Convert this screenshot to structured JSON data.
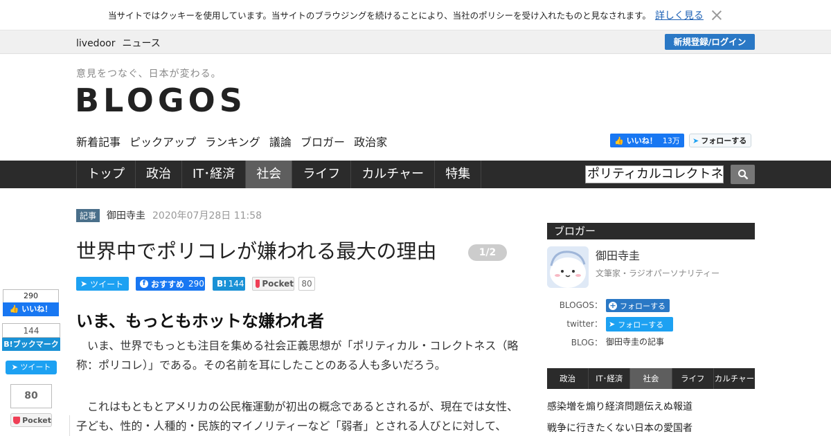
{
  "cookie": {
    "text": "当サイトではクッキーを使用しています。当サイトのブラウジングを続けることにより、当社のポリシーを受け入れたものと見なされます。",
    "link": "詳しく見る"
  },
  "topnav": {
    "brand1": "livedoor",
    "brand2": "ニュース",
    "login": "新規登録/ログイン"
  },
  "header": {
    "tagline": "意見をつなぐ、日本が変わる。",
    "logo": "BLOGOS",
    "sections": [
      "新着記事",
      "ピックアップ",
      "ランキング",
      "議論",
      "ブロガー",
      "政治家"
    ],
    "fb_like": "いいね！",
    "fb_like_count": "13万",
    "tw_follow": "フォローする"
  },
  "mainnav": {
    "items": [
      "トップ",
      "政治",
      "IT･経済",
      "社会",
      "ライフ",
      "カルチャー",
      "特集"
    ],
    "active": "社会",
    "search_value": "ポリティカルコレクトネ"
  },
  "article": {
    "tag": "記事",
    "author": "御田寺圭",
    "date": "2020年07月28日 11:58",
    "title": "世界中でポリコレが嫌われる最大の理由",
    "page": "1/2",
    "share": {
      "tweet": "ツイート",
      "fb": "おすすめ",
      "fb_count": "290",
      "hb": "B!",
      "hb_count": "144",
      "pocket": "Pocket",
      "pocket_count": "80"
    },
    "heading": "いま、もっともホットな嫌われ者",
    "p1": "　いま、世界でもっとも注目を集める社会正義思想が「ポリティカル・コレクトネス（略称：ポリコレ）」である。その名前を耳にしたことのある人も多いだろう。",
    "p2": "　これはもともとアメリカの公民権運動が初出の概念であるとされるが、現在では女性、子ども、性的・人種的・民族的マイノリティーなど「弱者」とされる人びとに対して、"
  },
  "floating": {
    "fb_count": "290",
    "fb_label": "いいね！",
    "hb_count": "144",
    "hb_label": "B!ブックマーク",
    "tweet": "ツイート",
    "pocket_count": "80",
    "pocket": "Pocket"
  },
  "sidebar": {
    "heading": "ブロガー",
    "name": "御田寺圭",
    "role": "文筆家・ラジオパーソナリティー",
    "blogos_label": "BLOGOS：",
    "blogos_btn": "フォローする",
    "twitter_label": "twitter：",
    "twitter_btn": "フォローする",
    "blog_label": "BLOG：",
    "blog_value": "御田寺圭の記事",
    "tabs": [
      "政治",
      "IT･経済",
      "社会",
      "ライフ",
      "カルチャー"
    ],
    "active_tab": "社会",
    "links": [
      "感染増を煽り経済問題伝えぬ報道",
      "戦争に行きたくない日本の愛国者"
    ]
  }
}
